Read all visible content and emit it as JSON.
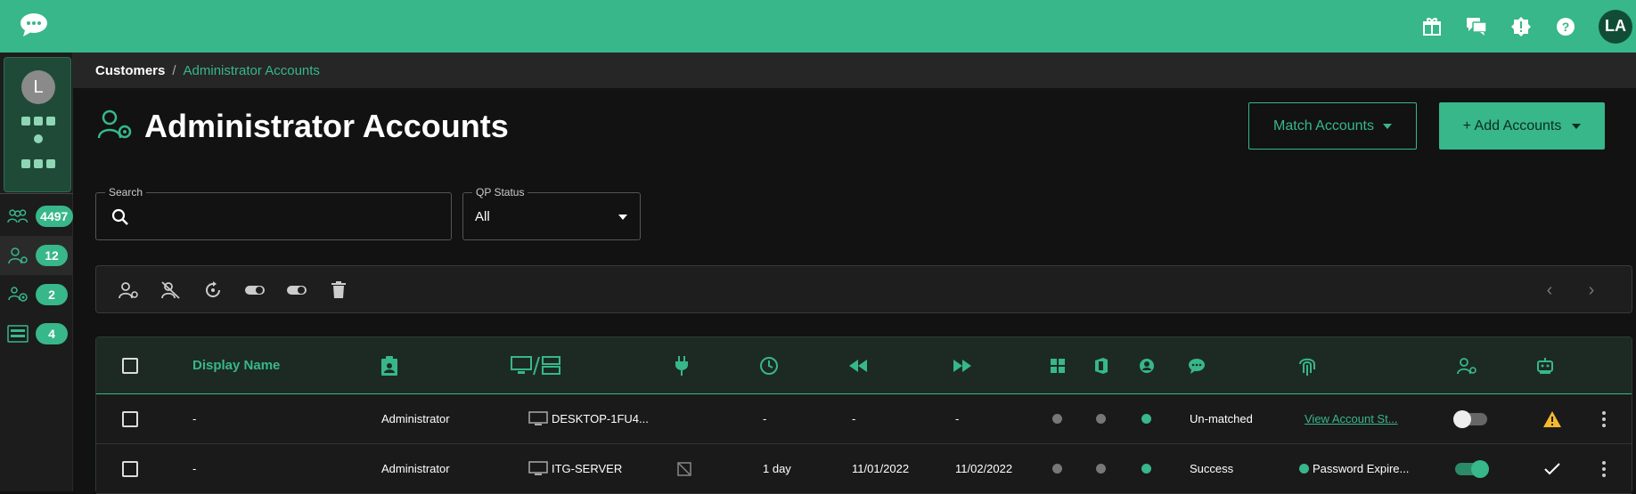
{
  "topbar": {
    "logo_icon": "chat-bubble-icon",
    "icons": [
      "gift-icon",
      "chat-icon",
      "alert-icon",
      "help-icon"
    ],
    "user_initials": "LA",
    "color": "#37b78a"
  },
  "sidebar": {
    "avatar_initial": "L",
    "items": [
      {
        "icon": "group-icon",
        "count": "4497"
      },
      {
        "icon": "admin-user-icon",
        "count": "12",
        "active": true
      },
      {
        "icon": "users-cog-icon",
        "count": "2"
      },
      {
        "icon": "server-icon",
        "count": "4"
      }
    ]
  },
  "breadcrumb": {
    "root": "Customers",
    "separator": "/",
    "current": "Administrator Accounts"
  },
  "page": {
    "title": "Administrator Accounts",
    "match_button": "Match Accounts",
    "add_button": "+ Add Accounts"
  },
  "filters": {
    "search_label": "Search",
    "search_value": "",
    "status_label": "QP Status",
    "status_value": "All"
  },
  "table": {
    "header": {
      "display_name": "Display Name"
    },
    "rows": [
      {
        "display_name": "-",
        "username": "Administrator",
        "device": "DESKTOP-1FU4...",
        "duration": "-",
        "last_date": "-",
        "next_date": "-",
        "status": "Un-matched",
        "account_link": "View Account St...",
        "enabled": false,
        "flag": "warning"
      },
      {
        "display_name": "-",
        "username": "Administrator",
        "device": "ITG-SERVER",
        "duration": "1 day",
        "last_date": "11/01/2022",
        "next_date": "11/02/2022",
        "status": "Success",
        "password_status": "Password Expire...",
        "enabled": true,
        "flag": "check"
      }
    ]
  }
}
